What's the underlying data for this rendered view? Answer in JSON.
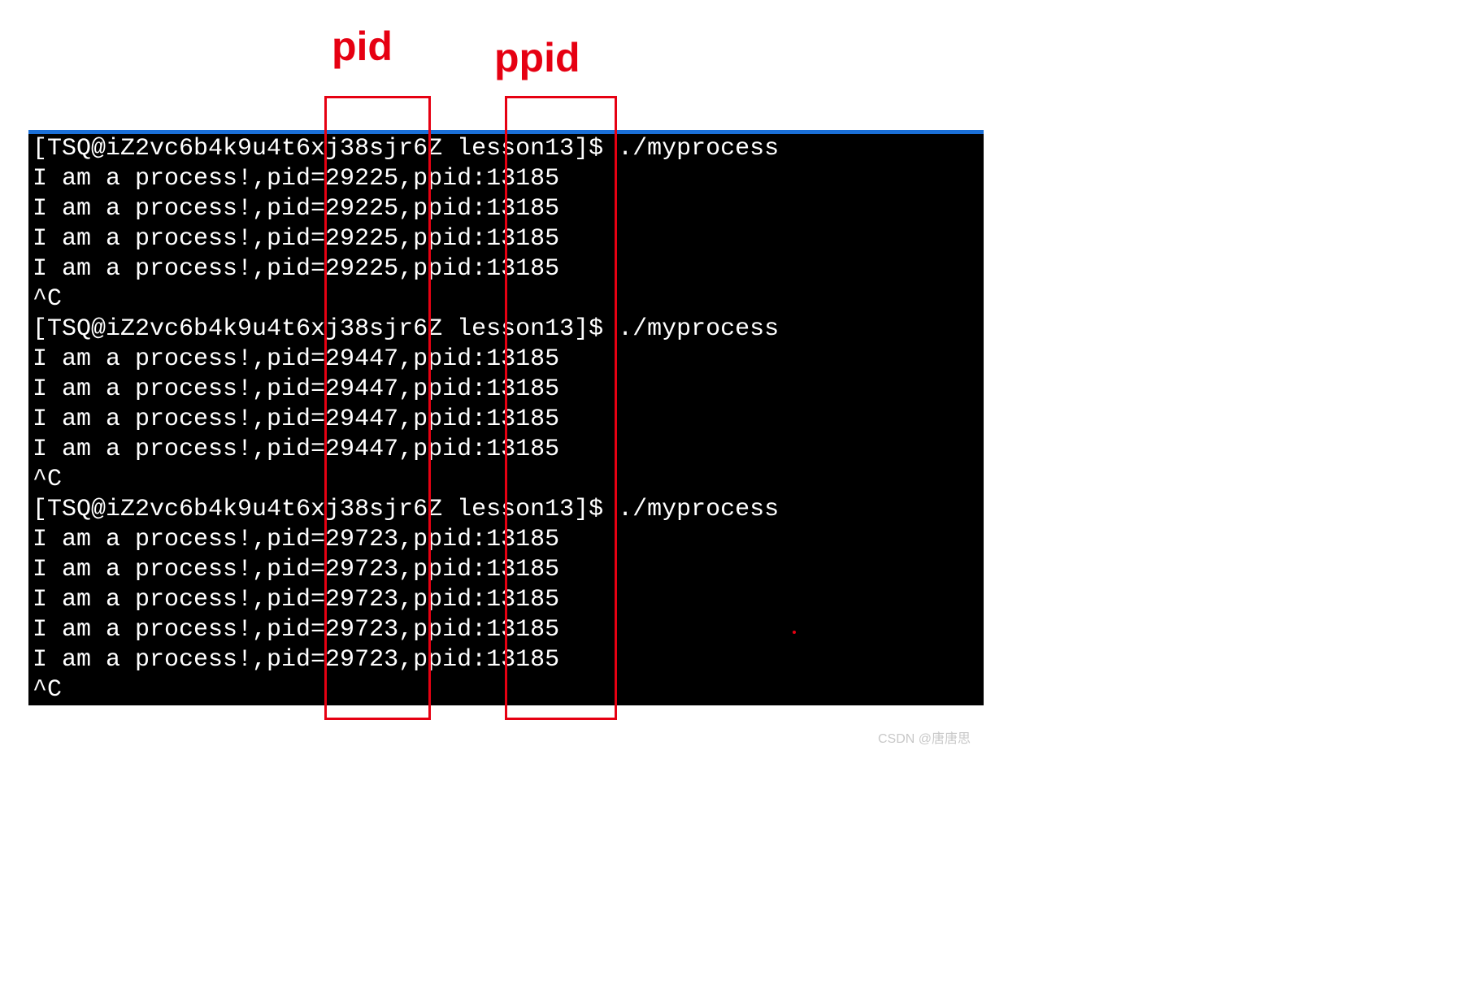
{
  "labels": {
    "pid_label": "pid",
    "ppid_label": "ppid"
  },
  "terminal": {
    "prompt": "[TSQ@iZ2vc6b4k9u4t6xj38sjr6Z lesson13]$ ",
    "command": "./myprocess",
    "interrupt": "^C",
    "line_prefix": "I am a process!,pid=",
    "ppid_prefix": ",ppid:",
    "blocks": [
      {
        "pid": "29225",
        "ppid": "13185",
        "count": 4
      },
      {
        "pid": "29447",
        "ppid": "13185",
        "count": 4
      },
      {
        "pid": "29723",
        "ppid": "13185",
        "count": 5
      }
    ]
  },
  "watermark": "CSDN @唐唐思"
}
